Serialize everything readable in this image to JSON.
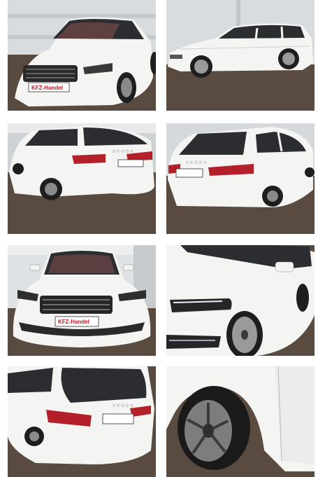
{
  "gallery": {
    "photos": [
      {
        "id": "front-three-quarter",
        "dealer_plate": "KFZ-Handel"
      },
      {
        "id": "side-profile"
      },
      {
        "id": "rear-left-three-quarter",
        "brand_lettering": "SKODA"
      },
      {
        "id": "rear-right-three-quarter",
        "brand_lettering": "SKODA"
      },
      {
        "id": "front-view",
        "dealer_plate": "KFZ-Handel"
      },
      {
        "id": "front-headlight-detail"
      },
      {
        "id": "rear-tailgate-detail",
        "brand_lettering": "SKODA"
      },
      {
        "id": "wheel-detail"
      }
    ]
  },
  "colors": {
    "car_body": "#f4f4f2",
    "cobblestone": "#5a4b40",
    "wall": "#d9dcdf",
    "glass": "#2b2d30",
    "taillight": "#b3202a"
  }
}
